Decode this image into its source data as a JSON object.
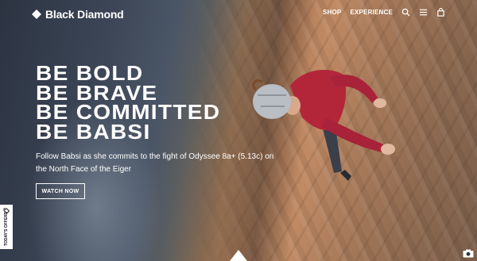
{
  "brand": {
    "name": "Black Diamond"
  },
  "nav": {
    "links": [
      "SHOP",
      "EXPERIENCE"
    ],
    "icons": [
      "search-icon",
      "menu-icon",
      "cart-icon"
    ]
  },
  "hero": {
    "headline": [
      "BE BOLD",
      "BE BRAVE",
      "BE COMMITTED",
      "BE BABSI"
    ],
    "subcopy": "Follow Babsi as she commits to the fight of Odyssee 8a+ (5.13c) on the North Face of the Eiger",
    "cta_label": "WATCH NOW"
  },
  "side_tab": {
    "label": "TODAY'S OFFERS",
    "icon": "tag-icon"
  },
  "colors": {
    "text": "#ffffff",
    "jacket": "#b3263a",
    "helmet": "#b9bdc4",
    "rock": "#c08a64"
  }
}
